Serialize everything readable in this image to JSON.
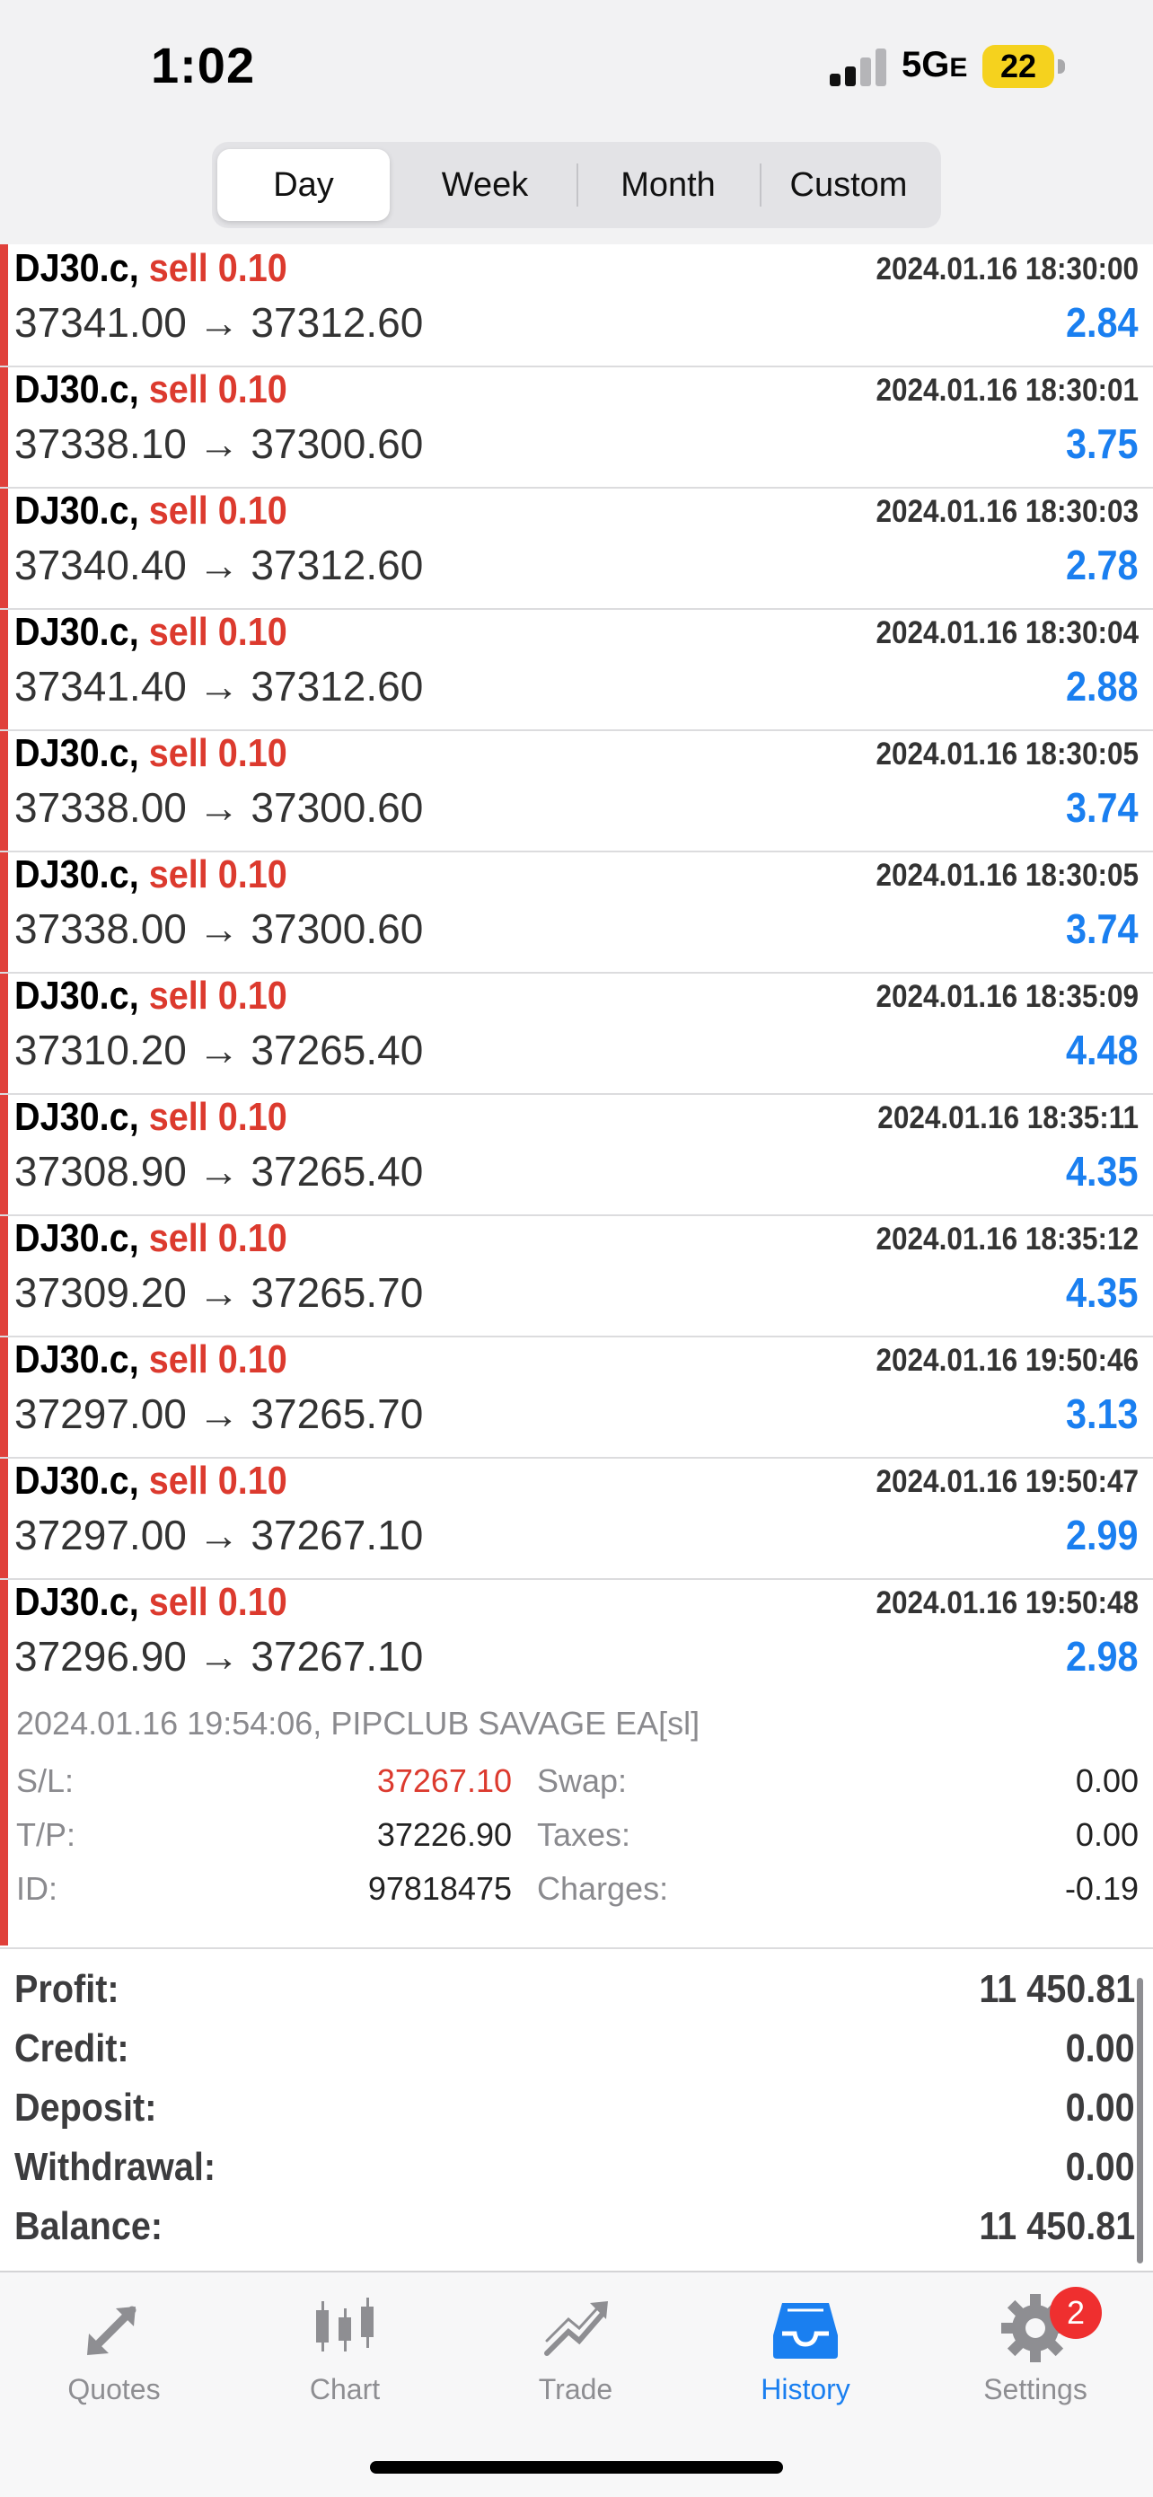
{
  "status_bar": {
    "time": "1:02",
    "network": "5G",
    "network_suffix": "E",
    "battery": "22"
  },
  "period_tabs": [
    {
      "label": "Day",
      "active": true
    },
    {
      "label": "Week",
      "active": false
    },
    {
      "label": "Month",
      "active": false
    },
    {
      "label": "Custom",
      "active": false
    }
  ],
  "trades": [
    {
      "symbol": "DJ30.c,",
      "side": "sell 0.10",
      "datetime": "2024.01.16 18:30:00",
      "prices": "37341.00 → 37312.60",
      "profit": "2.84"
    },
    {
      "symbol": "DJ30.c,",
      "side": "sell 0.10",
      "datetime": "2024.01.16 18:30:01",
      "prices": "37338.10 → 37300.60",
      "profit": "3.75"
    },
    {
      "symbol": "DJ30.c,",
      "side": "sell 0.10",
      "datetime": "2024.01.16 18:30:03",
      "prices": "37340.40 → 37312.60",
      "profit": "2.78"
    },
    {
      "symbol": "DJ30.c,",
      "side": "sell 0.10",
      "datetime": "2024.01.16 18:30:04",
      "prices": "37341.40 → 37312.60",
      "profit": "2.88"
    },
    {
      "symbol": "DJ30.c,",
      "side": "sell 0.10",
      "datetime": "2024.01.16 18:30:05",
      "prices": "37338.00 → 37300.60",
      "profit": "3.74"
    },
    {
      "symbol": "DJ30.c,",
      "side": "sell 0.10",
      "datetime": "2024.01.16 18:30:05",
      "prices": "37338.00 → 37300.60",
      "profit": "3.74"
    },
    {
      "symbol": "DJ30.c,",
      "side": "sell 0.10",
      "datetime": "2024.01.16 18:35:09",
      "prices": "37310.20 → 37265.40",
      "profit": "4.48"
    },
    {
      "symbol": "DJ30.c,",
      "side": "sell 0.10",
      "datetime": "2024.01.16 18:35:11",
      "prices": "37308.90 → 37265.40",
      "profit": "4.35"
    },
    {
      "symbol": "DJ30.c,",
      "side": "sell 0.10",
      "datetime": "2024.01.16 18:35:12",
      "prices": "37309.20 → 37265.70",
      "profit": "4.35"
    },
    {
      "symbol": "DJ30.c,",
      "side": "sell 0.10",
      "datetime": "2024.01.16 19:50:46",
      "prices": "37297.00 → 37265.70",
      "profit": "3.13"
    },
    {
      "symbol": "DJ30.c,",
      "side": "sell 0.10",
      "datetime": "2024.01.16 19:50:47",
      "prices": "37297.00 → 37267.10",
      "profit": "2.99"
    },
    {
      "symbol": "DJ30.c,",
      "side": "sell 0.10",
      "datetime": "2024.01.16 19:50:48",
      "prices": "37296.90 → 37267.10",
      "profit": "2.98"
    }
  ],
  "expanded": {
    "meta": "2024.01.16 19:54:06, PIPCLUB SAVAGE EA[sl]",
    "sl_label": "S/L:",
    "sl_value": "37267.10",
    "tp_label": "T/P:",
    "tp_value": "37226.90",
    "id_label": "ID:",
    "id_value": "97818475",
    "swap_label": "Swap:",
    "swap_value": "0.00",
    "taxes_label": "Taxes:",
    "taxes_value": "0.00",
    "charges_label": "Charges:",
    "charges_value": "-0.19"
  },
  "summary": [
    {
      "label": "Profit:",
      "value": "11 450.81"
    },
    {
      "label": "Credit:",
      "value": "0.00"
    },
    {
      "label": "Deposit:",
      "value": "0.00"
    },
    {
      "label": "Withdrawal:",
      "value": "0.00"
    },
    {
      "label": "Balance:",
      "value": "11 450.81"
    }
  ],
  "tab_bar": [
    {
      "label": "Quotes",
      "icon": "quotes-arrows-icon"
    },
    {
      "label": "Chart",
      "icon": "candlestick-icon"
    },
    {
      "label": "Trade",
      "icon": "trend-up-icon"
    },
    {
      "label": "History",
      "icon": "inbox-tray-icon",
      "active": true
    },
    {
      "label": "Settings",
      "icon": "gear-icon",
      "badge": "2"
    }
  ],
  "colors": {
    "accent": "#1a7ff0",
    "sell": "#dc3a2e",
    "badge": "#ef2f2f",
    "battery": "#f5d21e"
  }
}
